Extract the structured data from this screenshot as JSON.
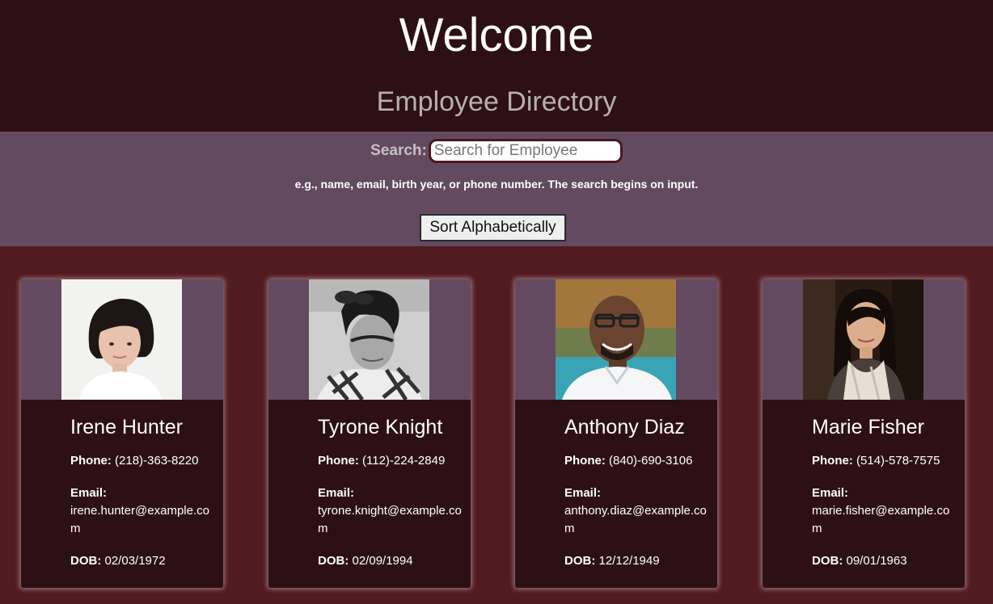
{
  "header": {
    "title": "Welcome",
    "subtitle": "Employee Directory"
  },
  "search": {
    "label": "Search:",
    "placeholder": "Search for Employee",
    "value": "",
    "hint": "e.g., name, email, birth year, or phone number. The search begins on input."
  },
  "toolbar": {
    "sort_label": "Sort Alphabetically"
  },
  "field_labels": {
    "phone": "Phone:",
    "email": "Email:",
    "dob": "DOB:"
  },
  "employees": [
    {
      "name": "Irene Hunter",
      "phone": "(218)-363-8220",
      "email": "irene.hunter@example.com",
      "dob": "02/03/1972",
      "photo": "woman-portrait"
    },
    {
      "name": "Tyrone Knight",
      "phone": "(112)-224-2849",
      "email": "tyrone.knight@example.com",
      "dob": "02/09/1994",
      "photo": "man-portrait-grayscale"
    },
    {
      "name": "Anthony Diaz",
      "phone": "(840)-690-3106",
      "email": "anthony.diaz@example.com",
      "dob": "12/12/1949",
      "photo": "man-portrait-glasses"
    },
    {
      "name": "Marie Fisher",
      "phone": "(514)-578-7575",
      "email": "marie.fisher@example.com",
      "dob": "09/01/1963",
      "photo": "woman-portrait-dark"
    }
  ],
  "colors": {
    "page_background": "#521b20",
    "header_background": "#2d1016",
    "band_background": "#644a60",
    "card_background": "#2d1016"
  }
}
